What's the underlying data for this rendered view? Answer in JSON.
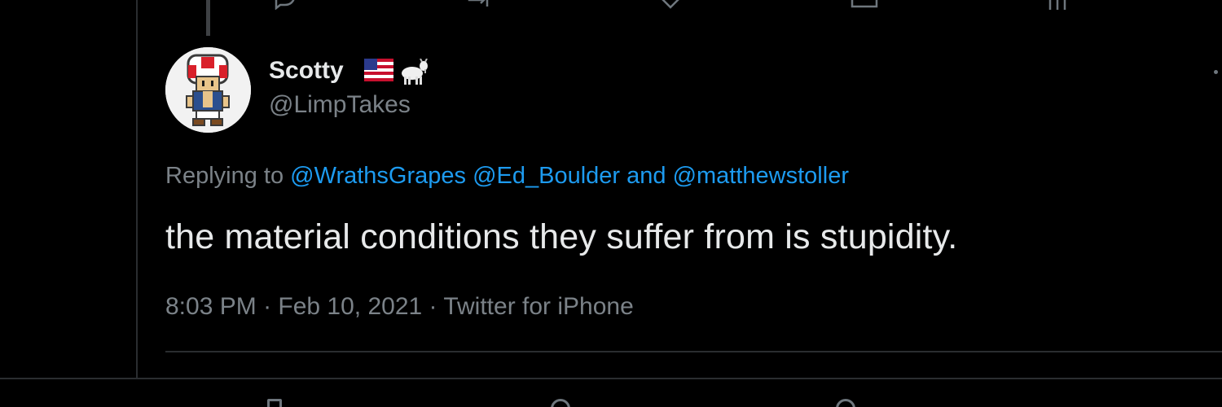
{
  "tweet": {
    "display_name": "Scotty",
    "name_emoji_1": "us-flag",
    "name_emoji_2": "goat",
    "handle": "@LimpTakes",
    "replying_prefix": "Replying to ",
    "mentions": [
      "@WrathsGrapes",
      "@Ed_Boulder",
      "@matthewstoller"
    ],
    "mention_joiner_and": " and ",
    "text": "the material conditions they suffer from is stupidity.",
    "time": "8:03 PM",
    "date": "Feb 10, 2021",
    "source": "Twitter for iPhone",
    "separator": " · "
  },
  "actions_top": [
    "reply-icon",
    "retweet-icon",
    "like-icon",
    "share-icon",
    "analytics-icon"
  ],
  "colors": {
    "background": "#000000",
    "text_primary": "#e7e9ea",
    "text_secondary": "#7b8288",
    "link": "#1d9bf0",
    "border": "#2a2d30"
  }
}
